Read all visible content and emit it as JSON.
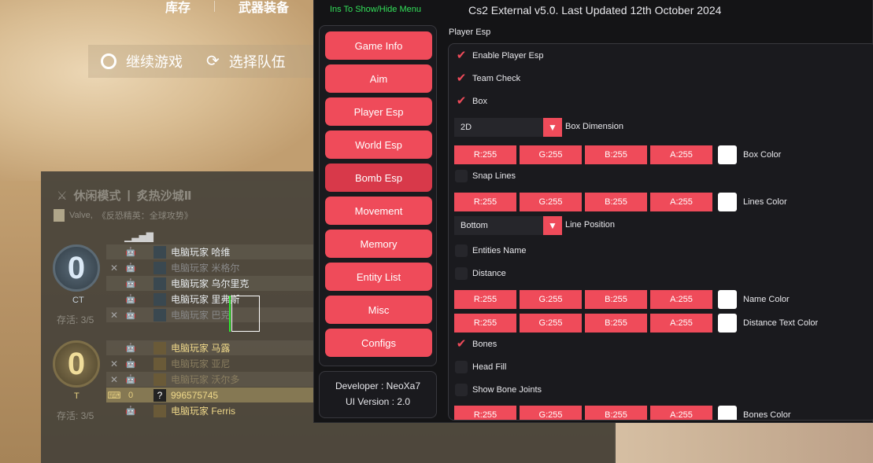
{
  "background": {
    "topbar": [
      "库存",
      "武器装备"
    ],
    "menu": [
      {
        "icon": "resume-icon",
        "label": "继续游戏"
      },
      {
        "icon": "refresh-icon",
        "label": "选择队伍"
      }
    ]
  },
  "scoreboard": {
    "mode": "休闲模式",
    "map": "炙热沙城Ⅱ",
    "subtitle_owner": "Valve,",
    "subtitle_game": "《反恐精英：全球攻势》",
    "ct": {
      "score": "0",
      "label": "CT",
      "alive": "存活: 3/5"
    },
    "t": {
      "score": "0",
      "label": "T",
      "alive": "存活: 3/5"
    },
    "ct_players": [
      {
        "name": "电脑玩家 哈维",
        "dead": false
      },
      {
        "name": "电脑玩家 米格尔",
        "dead": true
      },
      {
        "name": "电脑玩家 乌尔里克",
        "dead": false
      },
      {
        "name": "电脑玩家 里弗斯",
        "dead": false
      },
      {
        "name": "电脑玩家 巴克",
        "dead": true
      }
    ],
    "t_players": [
      {
        "name": "电脑玩家 马露",
        "dead": false
      },
      {
        "name": "电脑玩家 亚尼",
        "dead": true
      },
      {
        "name": "电脑玩家 沃尔多",
        "dead": true
      },
      {
        "name": "996575745",
        "dead": false,
        "score": "0"
      },
      {
        "name": "电脑玩家 Ferris",
        "dead": false
      }
    ]
  },
  "cheat": {
    "hint": "Ins To Show/Hide Menu",
    "title": "Cs2 External v5.0. Last Updated 12th October 2024",
    "section": "Player Esp",
    "nav": [
      "Game Info",
      "Aim",
      "Player Esp",
      "World Esp",
      "Bomb Esp",
      "Movement",
      "Memory",
      "Entity List",
      "Misc",
      "Configs"
    ],
    "active_nav": "Bomb Esp",
    "developer": "Developer : NeoXa7",
    "ui_version": "UI Version : 2.0",
    "options": {
      "enable_player_esp": {
        "label": "Enable Player Esp",
        "checked": true
      },
      "team_check": {
        "label": "Team Check",
        "checked": true
      },
      "box": {
        "label": "Box",
        "checked": true
      },
      "box_dimension": {
        "value": "2D",
        "label": "Box Dimension"
      },
      "box_color": {
        "r": "R:255",
        "g": "G:255",
        "b": "B:255",
        "a": "A:255",
        "label": "Box Color"
      },
      "snap_lines": {
        "label": "Snap Lines",
        "checked": false
      },
      "lines_color": {
        "r": "R:255",
        "g": "G:255",
        "b": "B:255",
        "a": "A:255",
        "label": "Lines Color"
      },
      "line_position": {
        "value": "Bottom",
        "label": "Line Position"
      },
      "entities_name": {
        "label": "Entities Name",
        "checked": false
      },
      "distance": {
        "label": "Distance",
        "checked": false
      },
      "name_color": {
        "r": "R:255",
        "g": "G:255",
        "b": "B:255",
        "a": "A:255",
        "label": "Name Color"
      },
      "distance_text_color": {
        "r": "R:255",
        "g": "G:255",
        "b": "B:255",
        "a": "A:255",
        "label": "Distance Text Color"
      },
      "bones": {
        "label": "Bones",
        "checked": true
      },
      "head_fill": {
        "label": "Head Fill",
        "checked": false
      },
      "show_bone_joints": {
        "label": "Show Bone Joints",
        "checked": false
      },
      "bones_color": {
        "r": "R:255",
        "g": "G:255",
        "b": "B:255",
        "a": "A:255",
        "label": "Bones Color"
      }
    },
    "colors": {
      "accent": "#ef4b5a",
      "hint": "#33e05a",
      "panel": "#1a1a1e"
    }
  }
}
